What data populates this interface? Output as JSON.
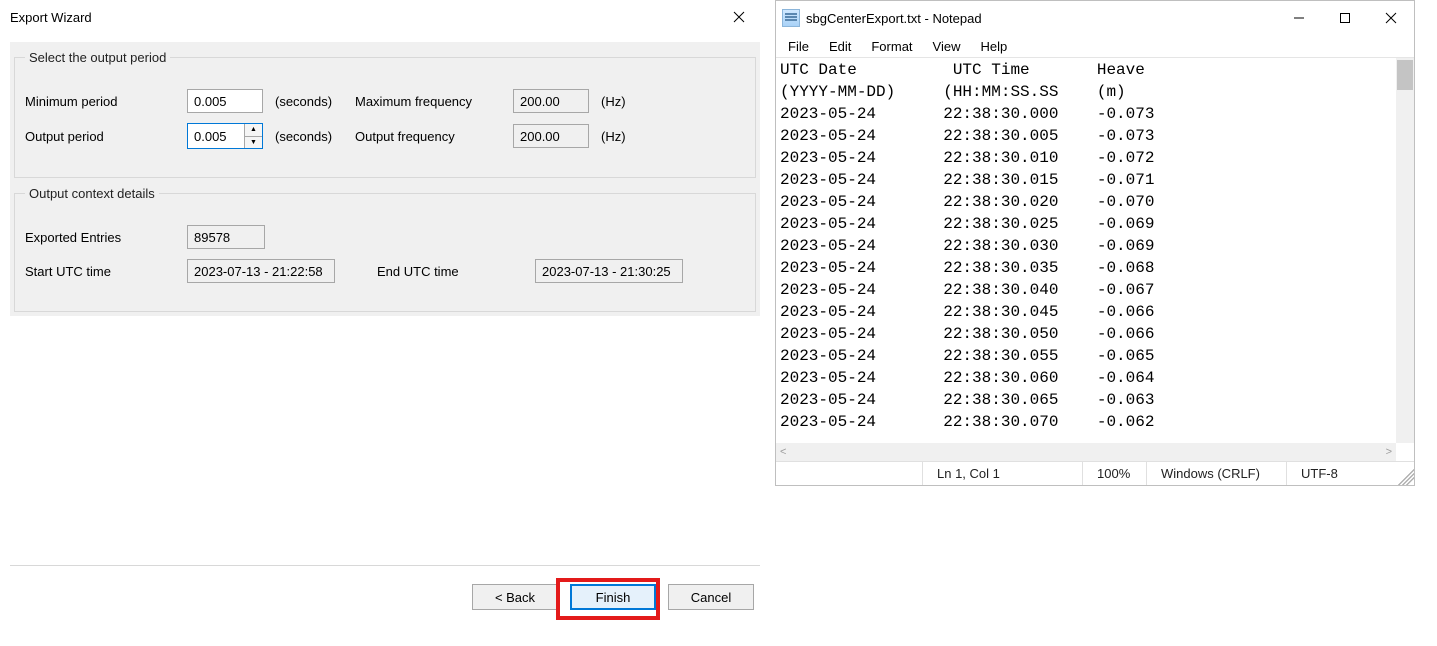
{
  "wizard": {
    "title": "Export Wizard",
    "fs_period": {
      "legend": "Select the output period",
      "min_period_label": "Minimum period",
      "min_period": "0.005",
      "seconds": "(seconds)",
      "max_freq_label": "Maximum frequency",
      "max_freq": "200.00",
      "hz": "(Hz)",
      "out_period_label": "Output period",
      "out_period": "0.005",
      "out_freq_label": "Output frequency",
      "out_freq": "200.00"
    },
    "fs_context": {
      "legend": "Output context details",
      "entries_label": "Exported Entries",
      "entries": "89578",
      "start_label": "Start UTC time",
      "start": "2023-07-13 - 21:22:58",
      "end_label": "End UTC time",
      "end": "2023-07-13 - 21:30:25"
    },
    "buttons": {
      "back": "< Back",
      "finish": "Finish",
      "cancel": "Cancel"
    }
  },
  "notepad": {
    "title": "sbgCenterExport.txt - Notepad",
    "menu": [
      "File",
      "Edit",
      "Format",
      "View",
      "Help"
    ],
    "header_line1": "UTC Date          UTC Time       Heave",
    "header_line2": "(YYYY-MM-DD)     (HH:MM:SS.SS    (m)",
    "rows": [
      [
        "2023-05-24",
        "22:38:30.000",
        "-0.073"
      ],
      [
        "2023-05-24",
        "22:38:30.005",
        "-0.073"
      ],
      [
        "2023-05-24",
        "22:38:30.010",
        "-0.072"
      ],
      [
        "2023-05-24",
        "22:38:30.015",
        "-0.071"
      ],
      [
        "2023-05-24",
        "22:38:30.020",
        "-0.070"
      ],
      [
        "2023-05-24",
        "22:38:30.025",
        "-0.069"
      ],
      [
        "2023-05-24",
        "22:38:30.030",
        "-0.069"
      ],
      [
        "2023-05-24",
        "22:38:30.035",
        "-0.068"
      ],
      [
        "2023-05-24",
        "22:38:30.040",
        "-0.067"
      ],
      [
        "2023-05-24",
        "22:38:30.045",
        "-0.066"
      ],
      [
        "2023-05-24",
        "22:38:30.050",
        "-0.066"
      ],
      [
        "2023-05-24",
        "22:38:30.055",
        "-0.065"
      ],
      [
        "2023-05-24",
        "22:38:30.060",
        "-0.064"
      ],
      [
        "2023-05-24",
        "22:38:30.065",
        "-0.063"
      ],
      [
        "2023-05-24",
        "22:38:30.070",
        "-0.062"
      ]
    ],
    "status": {
      "pos": "Ln 1, Col 1",
      "zoom": "100%",
      "eol": "Windows (CRLF)",
      "enc": "UTF-8"
    }
  }
}
